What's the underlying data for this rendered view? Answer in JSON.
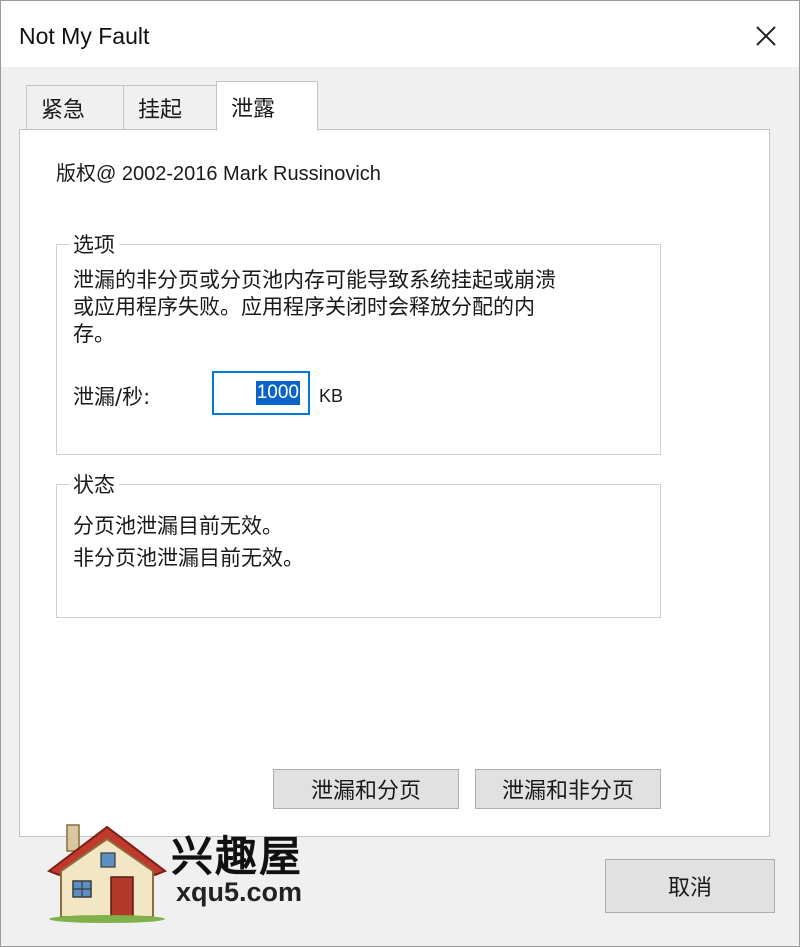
{
  "window": {
    "title": "Not My Fault"
  },
  "tabs": [
    {
      "label": "紧急"
    },
    {
      "label": "挂起"
    },
    {
      "label": "泄露"
    }
  ],
  "panel": {
    "copyright": "版权@ 2002-2016 Mark Russinovich",
    "options": {
      "title": "选项",
      "description_lines": [
        "泄漏的非分页或分页池内存可能导致系统挂起或崩溃",
        "或应用程序失败。应用程序关闭时会释放分配的内",
        "存。"
      ],
      "rate_label": "泄漏/秒:",
      "rate_value": "1000",
      "rate_unit": "KB"
    },
    "status": {
      "title": "状态",
      "lines": [
        "分页池泄漏目前无效。",
        "非分页池泄漏目前无效。"
      ]
    },
    "buttons": {
      "leak_paged": "泄漏和分页",
      "leak_nonpaged": "泄漏和非分页"
    }
  },
  "footer": {
    "cancel": "取消"
  },
  "watermark": {
    "name": "兴趣屋",
    "url": "xqu5.com"
  },
  "colors": {
    "accent": "#0078d7",
    "selection": "#0a64c8",
    "house_roof": "#c0392b"
  }
}
